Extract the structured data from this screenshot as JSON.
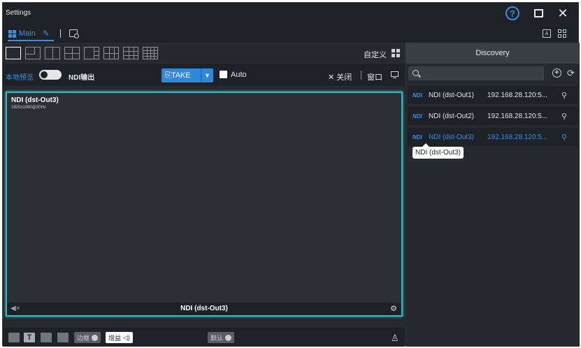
{
  "window": {
    "title": "Settings"
  },
  "tabs": {
    "main_label": "Main"
  },
  "layout": {
    "custom_label": "自定义"
  },
  "controls": {
    "local_preview": "本地预览",
    "ndi_output": "NDI输出",
    "take_label": "TAKE",
    "auto_label": "Auto",
    "close_label": "关闭",
    "window_label": "窗口"
  },
  "discovery": {
    "title": "Discovery",
    "search_value": "",
    "items": [
      {
        "name": "NDI (dst-Out1)",
        "ip": "192.168.28.120:5...",
        "logo": "NDI"
      },
      {
        "name": "NDI (dst-Out2)",
        "ip": "192.168.28.120:5...",
        "logo": "NDI"
      },
      {
        "name": "NDI (dst-Out3)",
        "ip": "192.168.28.120:5...",
        "logo": "NDI"
      }
    ],
    "tooltip": "NDI (dst-Out3)"
  },
  "preview": {
    "source_name": "NDI (dst-Out3)",
    "resolution": "1920x1080@30Hz",
    "bottom_name": "NDI (dst-Out3)"
  },
  "bottombar": {
    "t_label": "T",
    "border_label": "边框",
    "gain_label": "增益",
    "default_label": "默认"
  },
  "icons": {
    "help": "help-icon",
    "maximize": "maximize-icon",
    "close": "close-icon",
    "grid": "grid-icon",
    "edit": "pencil-icon",
    "new-tab": "new-tab-icon",
    "search": "search-icon",
    "add": "add-circle-icon",
    "refresh": "refresh-icon",
    "pin": "pin-icon",
    "volume": "volume-icon",
    "settings": "gear-icon"
  },
  "colors": {
    "accent": "#3a8fe0",
    "preview_border": "#35b8c3",
    "background": "#26292d"
  }
}
